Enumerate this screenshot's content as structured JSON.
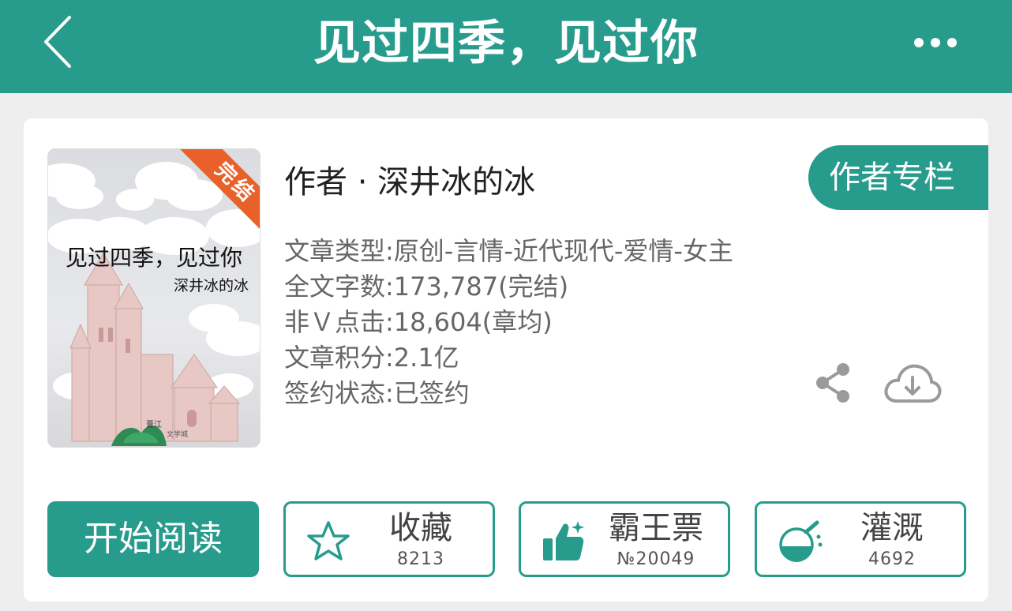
{
  "header": {
    "title": "见过四季，见过你",
    "back_icon": "chevron-left-icon",
    "more_icon": "more-dots-icon",
    "color": "#279c8c"
  },
  "book": {
    "cover": {
      "title": "见过四季，见过你",
      "author": "深井冰的冰",
      "badge": "完结",
      "badge_color": "#e8612b",
      "logo_text": "晋江文学城"
    },
    "author_line": "作者 · 深井冰的冰",
    "author_column_label": "作者专栏",
    "info": [
      "文章类型:原创-言情-近代现代-爱情-女主",
      "全文字数:173,787(完结)",
      "非Ｖ点击:18,604(章均)",
      "文章积分:2.1亿",
      "签约状态:已签约"
    ]
  },
  "actions": {
    "share_icon": "share-icon",
    "download_icon": "cloud-download-icon",
    "read_label": "开始阅读",
    "buttons": [
      {
        "label": "收藏",
        "count": "8213",
        "icon": "star-icon"
      },
      {
        "label": "霸王票",
        "count": "№20049",
        "icon": "thumbs-up-icon"
      },
      {
        "label": "灌溉",
        "count": "4692",
        "icon": "watering-flask-icon"
      }
    ]
  }
}
